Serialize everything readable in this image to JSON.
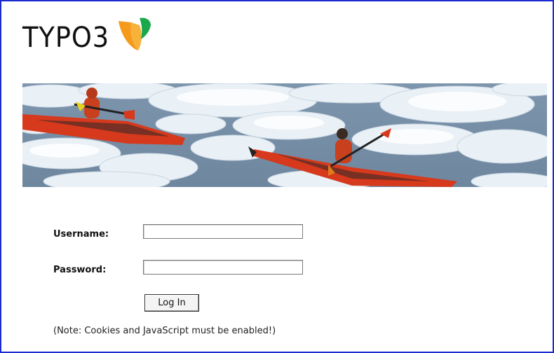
{
  "header": {
    "logo_text": "TYPO3",
    "logo_icon": "typo3-flame-icon",
    "colors": {
      "orange": "#f59a1a",
      "green": "#1aa84a",
      "frame_border": "#1a2ad0"
    }
  },
  "banner": {
    "image": "kayakers-in-ice-floes-banner"
  },
  "login_form": {
    "username_label": "Username:",
    "username_value": "",
    "password_label": "Password:",
    "password_value": "",
    "login_button_label": "Log In",
    "note": "(Note: Cookies and JavaScript must be enabled!)"
  }
}
